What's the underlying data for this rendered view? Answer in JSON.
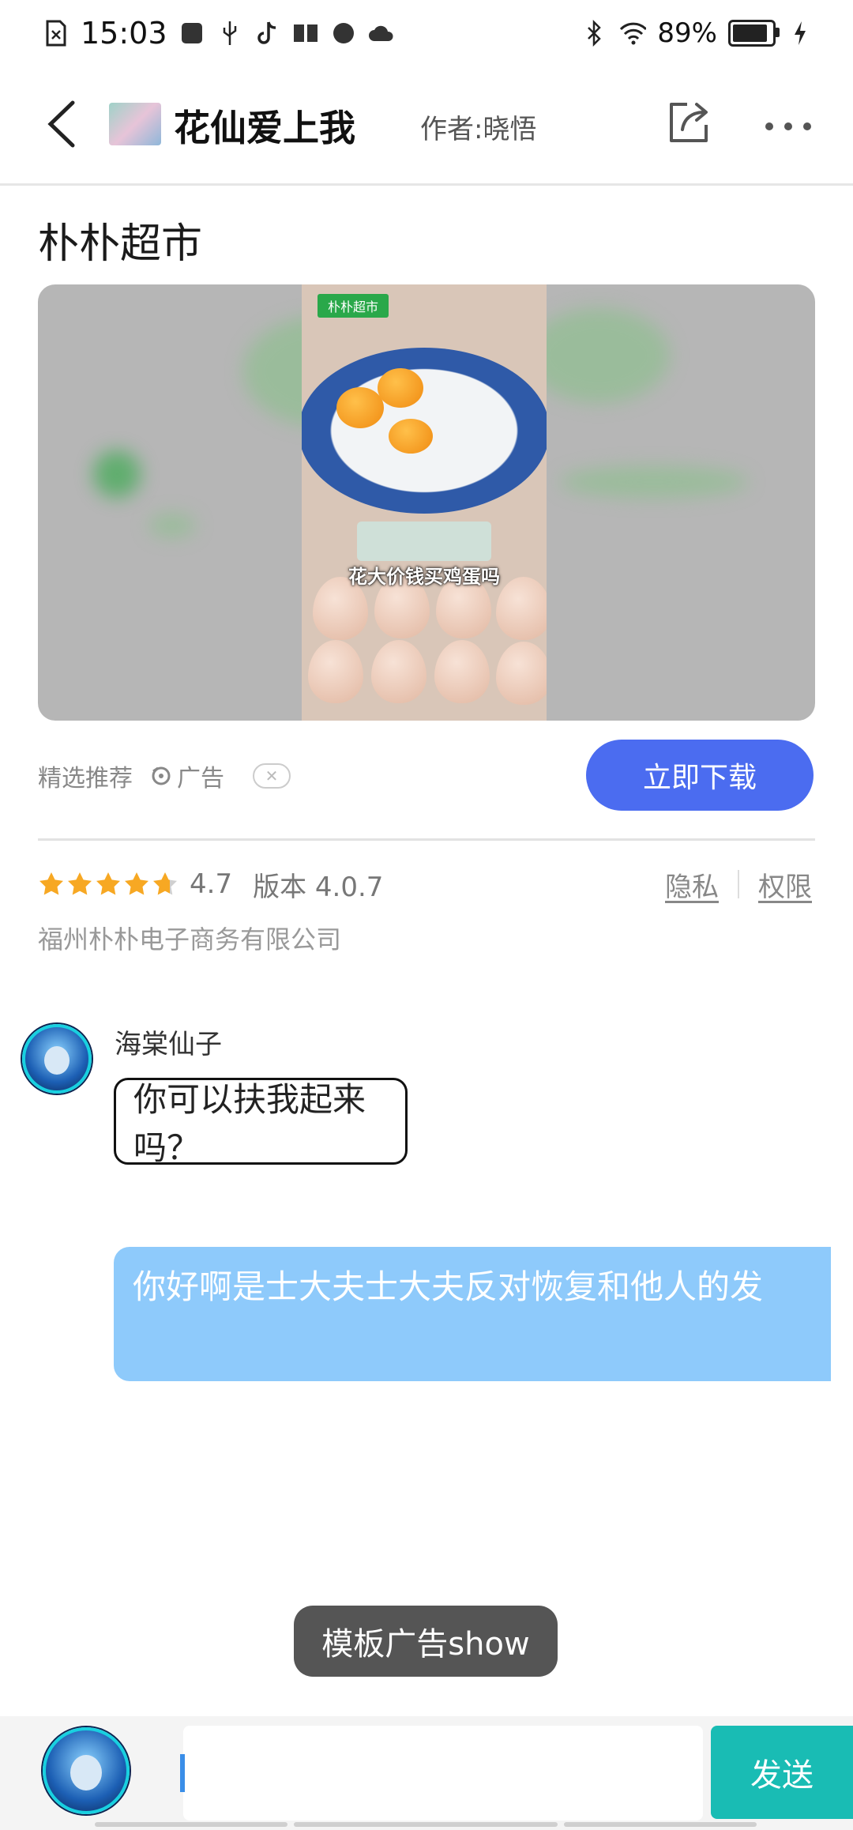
{
  "status_bar": {
    "time": "15:03",
    "battery": "89%",
    "battery_level": 0.89
  },
  "app_bar": {
    "title": "花仙爱上我",
    "author": "作者:晓悟"
  },
  "ad": {
    "title": "朴朴超市",
    "video_tag": "朴朴超市",
    "video_caption": "花大价钱买鸡蛋吗",
    "recommend_label": "精选推荐",
    "ad_label": "广告",
    "download_label": "立即下载",
    "rating": "4.7",
    "rating_value": 4.7,
    "version": "版本 4.0.7",
    "privacy_label": "隐私",
    "permission_label": "权限",
    "company": "福州朴朴电子商务有限公司"
  },
  "chat": {
    "incoming_name": "海棠仙子",
    "incoming_text": "你可以扶我起来吗？",
    "outgoing_text": "你好啊是士大夫士大夫反对恢复和他人的发"
  },
  "toast": "模板广告show",
  "input": {
    "value": "",
    "send_label": "发送"
  },
  "colors": {
    "download_button": "#4b6cf0",
    "send_button": "#19bcb4",
    "outgoing_bubble": "#8ecafb",
    "star": "#f7a823"
  }
}
